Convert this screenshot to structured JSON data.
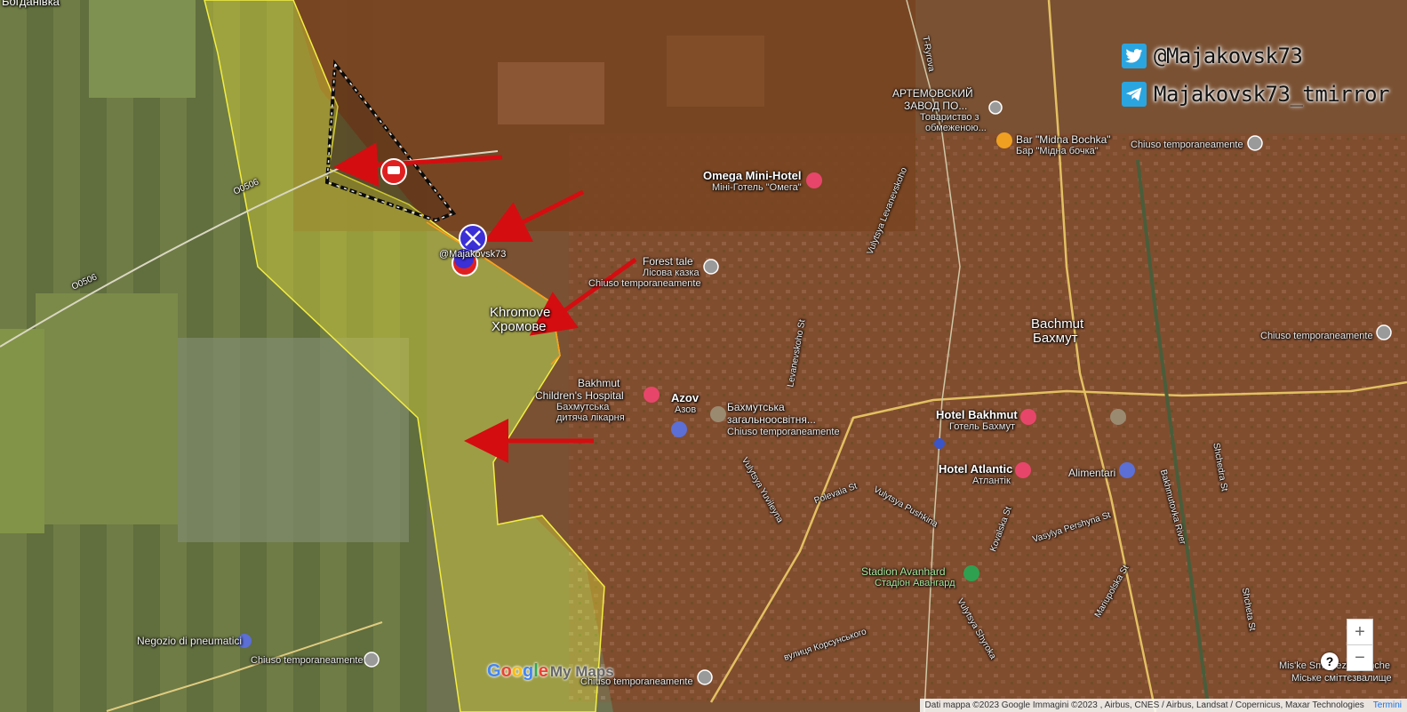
{
  "social": {
    "twitter_handle": "@Majakovsk73",
    "telegram_handle": "Majakovsk73_tmirror",
    "twitter_icon": "twitter-bird-icon",
    "telegram_icon": "telegram-plane-icon"
  },
  "watermark": "@Majakovsk73",
  "places": {
    "top_left_village": "Богданівка",
    "khromove_latin": "Khromove",
    "khromove_cyrillic": "Хромове",
    "bakhmut_latin": "Bachmut",
    "bakhmut_cyrillic": "Бахмут"
  },
  "pois": {
    "artemovsky_1": "АРТЕМОВСКИЙ",
    "artemovsky_2": "ЗАВОД ПО...",
    "artemovsky_3": "Товариство з",
    "artemovsky_4": "обмеженою...",
    "bar_latin": "Bar \"Midna Bochka\"",
    "bar_cyrillic": "Бар \"Мідна бочка\"",
    "closed_1": "Chiuso temporaneamente",
    "omega_latin": "Omega Mini-Hotel",
    "omega_cyrillic": "Міні-Готель \"Омега\"",
    "forest_latin": "Forest tale",
    "forest_cyrillic": "Лісова казка",
    "forest_closed": "Chiuso temporaneamente",
    "hospital_1": "Bakhmut",
    "hospital_2": "Children's Hospital",
    "hospital_3": "Бахмутська",
    "hospital_4": "дитяча лікарня",
    "azov_latin": "Azov",
    "azov_cyrillic": "Азов",
    "school_1": "Бахмутська",
    "school_2": "загальноосвітня...",
    "school_closed": "Chiuso temporaneamente",
    "hotel_bakhmut_latin": "Hotel Bakhmut",
    "hotel_bakhmut_cyrillic": "Готель Бахмут",
    "hotel_atlantic_latin": "Hotel Atlantic",
    "hotel_atlantic_cyrillic": "Атлантік",
    "alimentari": "Alimentari",
    "east_closed": "Chiuso temporaneamente",
    "stadium_latin": "Stadion Avanhard",
    "stadium_cyrillic": "Стадіон Авангард",
    "tyres": "Negozio di pneumatici",
    "tyres_closed": "Chiuso temporaneamente",
    "bottom_closed": "Chiuso temporaneamente",
    "miske_latin": "Mis'ke Smittyezvalyshche",
    "miske_cyrillic": "Міське сміттєзвалище"
  },
  "streets": {
    "o0506_a": "O0506",
    "o0506_b": "O0506",
    "tyryrova": "T-Ryrova",
    "levanevskoho": "Vulytsya Levanevskoho",
    "levanevskoho_st": "Levanevskoho St",
    "yuvileyna": "Vulytsya Yuvileyna",
    "polevaia": "Polevaia St",
    "pushkina": "Vulytsya Pushkina",
    "kovalska": "Kovalska St",
    "pershyna": "Vasylya Pershyna St",
    "shyroka": "Vulytsya Shyroka",
    "korsunskoho": "вулиця Корсунського",
    "mariupolska": "Mariupolska St",
    "bakhmutka_river": "Bakhmutovka River",
    "shchedra": "Shchedra St",
    "shcheta": "Shcheta St"
  },
  "controls": {
    "zoom_in": "+",
    "zoom_out": "−",
    "help": "?"
  },
  "branding": {
    "google_g": "G",
    "google_o1": "o",
    "google_o2": "o",
    "google_g2": "g",
    "google_l": "l",
    "google_e": "e",
    "mymaps": "My Maps"
  },
  "attribution": {
    "text": "Dati mappa ©2023 Google Immagini ©2023 , Airbus, CNES / Airbus, Landsat / Copernicus, Maxar Technologies",
    "terms": "Termini"
  },
  "colors": {
    "yellow_zone": "#c9c23a",
    "red_zone": "#8a2a10",
    "arrow": "#d40d10",
    "twitter_blue": "#2aa5e0",
    "unit_marker": "#3b2fd6"
  }
}
